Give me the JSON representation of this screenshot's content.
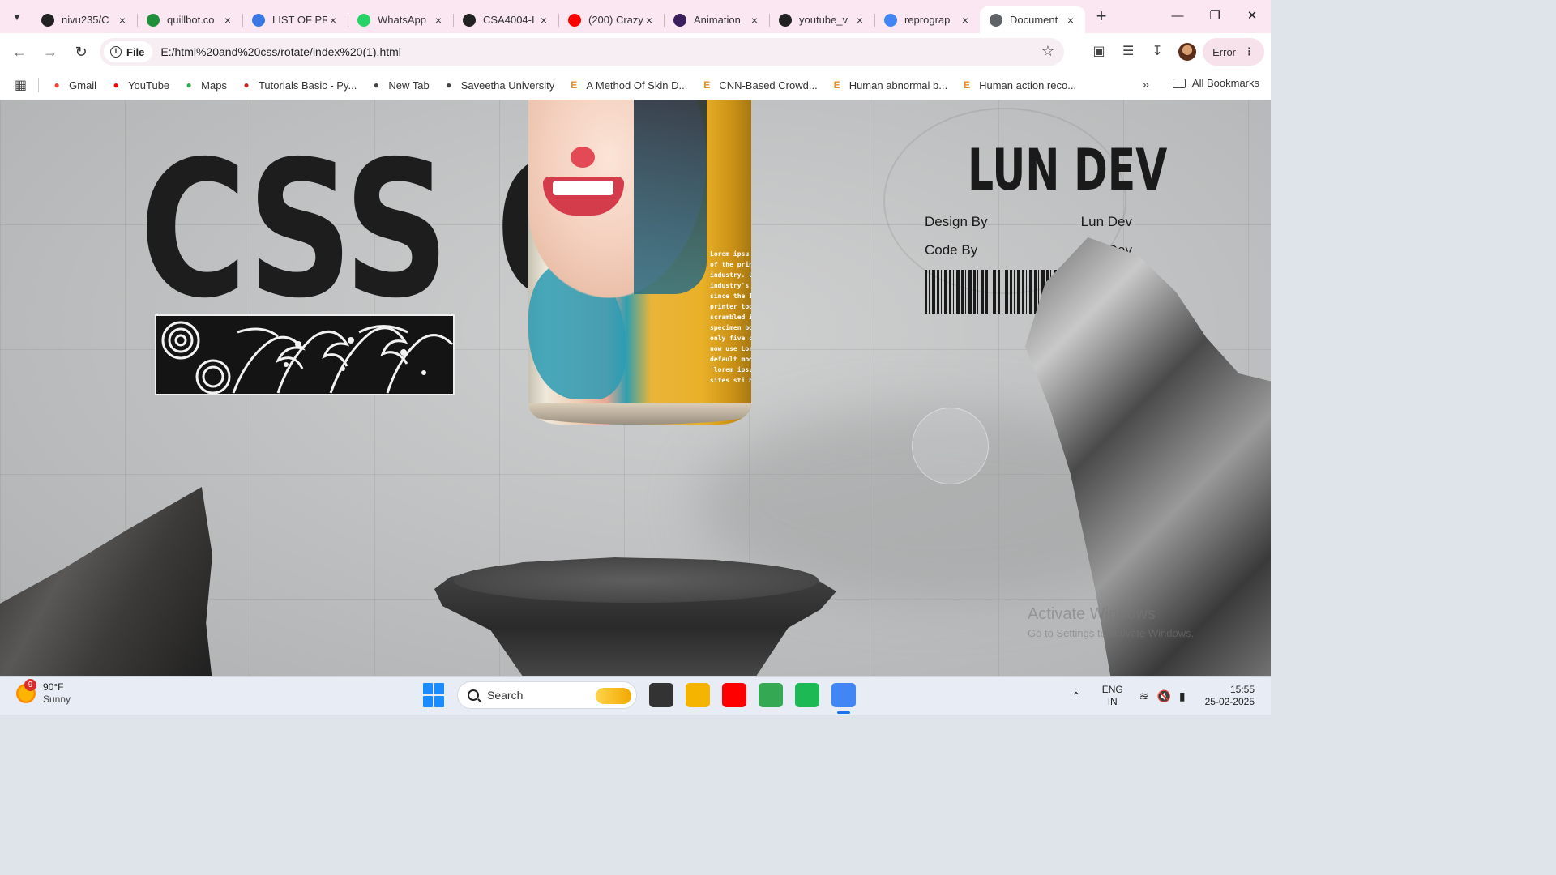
{
  "browser": {
    "tabs": [
      {
        "title": "nivu235/C",
        "icon": "github-icon",
        "color": "#222222",
        "active": false
      },
      {
        "title": "quillbot.co",
        "icon": "quillbot-icon",
        "color": "#1f8f3a",
        "active": false
      },
      {
        "title": "LIST OF PR",
        "icon": "docs-icon",
        "color": "#3b78e7",
        "active": false
      },
      {
        "title": "WhatsApp",
        "icon": "whatsapp-icon",
        "color": "#25d366",
        "active": false
      },
      {
        "title": "CSA4004-I",
        "icon": "github-icon",
        "color": "#222222",
        "active": false
      },
      {
        "title": "(200) Crazy",
        "icon": "youtube-icon",
        "color": "#ff0000",
        "active": false
      },
      {
        "title": "Animation",
        "icon": "figma-icon",
        "color": "#3a1d5c",
        "active": false
      },
      {
        "title": "youtube_v",
        "icon": "github-icon",
        "color": "#222222",
        "active": false
      },
      {
        "title": "reprograp",
        "icon": "google-icon",
        "color": "#4285f4",
        "active": false
      },
      {
        "title": "Document",
        "icon": "globe-icon",
        "color": "#5f6368",
        "active": true
      }
    ],
    "url_chip": "File",
    "url": "E:/html%20and%20css/rotate/index%20(1).html",
    "profile_error": "Error",
    "bookmarks": [
      {
        "label": "Gmail",
        "icon": "gmail-icon",
        "color": "#ea4335"
      },
      {
        "label": "YouTube",
        "icon": "youtube-icon",
        "color": "#ff0000"
      },
      {
        "label": "Maps",
        "icon": "maps-icon",
        "color": "#34a853"
      },
      {
        "label": "Tutorials Basic - Py...",
        "icon": "tutorials-icon",
        "color": "#c62828"
      },
      {
        "label": "New Tab",
        "icon": "globe-icon",
        "color": "#444444"
      },
      {
        "label": "Saveetha University",
        "icon": "globe-icon",
        "color": "#444444"
      },
      {
        "label": "A Method Of Skin D...",
        "icon": "e-icon",
        "color": "#f08a24"
      },
      {
        "label": "CNN-Based Crowd...",
        "icon": "e-icon",
        "color": "#f08a24"
      },
      {
        "label": "Human abnormal b...",
        "icon": "e-icon",
        "color": "#f08a24"
      },
      {
        "label": "Human action reco...",
        "icon": "e-icon",
        "color": "#f08a24"
      }
    ],
    "all_bookmarks": "All Bookmarks"
  },
  "page": {
    "title": "CSS ON",
    "brand": "LUN DEV",
    "credits": [
      {
        "label": "Design By",
        "value": "Lun Dev"
      },
      {
        "label": "Code By",
        "value": "Lun Dev"
      }
    ],
    "can_text": "Lorem ipsu\nof the print\nindustry. Lu\nindustry's s\nsince the 15\nprinter took\nscrambled i\nspecimen bo\nonly five ce\nnow use Lor\ndefault mod\n'lorem ips:n\nsites sti hav",
    "watermark": {
      "line1": "Activate Windows",
      "line2": "Go to Settings to activate Windows."
    }
  },
  "taskbar": {
    "weather_badge": "9",
    "temperature": "90°F",
    "condition": "Sunny",
    "search_placeholder": "Search",
    "apps": [
      {
        "name": "file-manager-icon",
        "color": "#333333"
      },
      {
        "name": "folder-icon",
        "color": "#f5b400"
      },
      {
        "name": "youtube-icon",
        "color": "#ff0000"
      },
      {
        "name": "chrome-icon",
        "color": "#34a853"
      },
      {
        "name": "spotify-icon",
        "color": "#1db954"
      },
      {
        "name": "chrome-profile-icon",
        "color": "#4285f4"
      }
    ],
    "lang_line1": "ENG",
    "lang_line2": "IN",
    "time": "15:55",
    "date": "25-02-2025"
  }
}
